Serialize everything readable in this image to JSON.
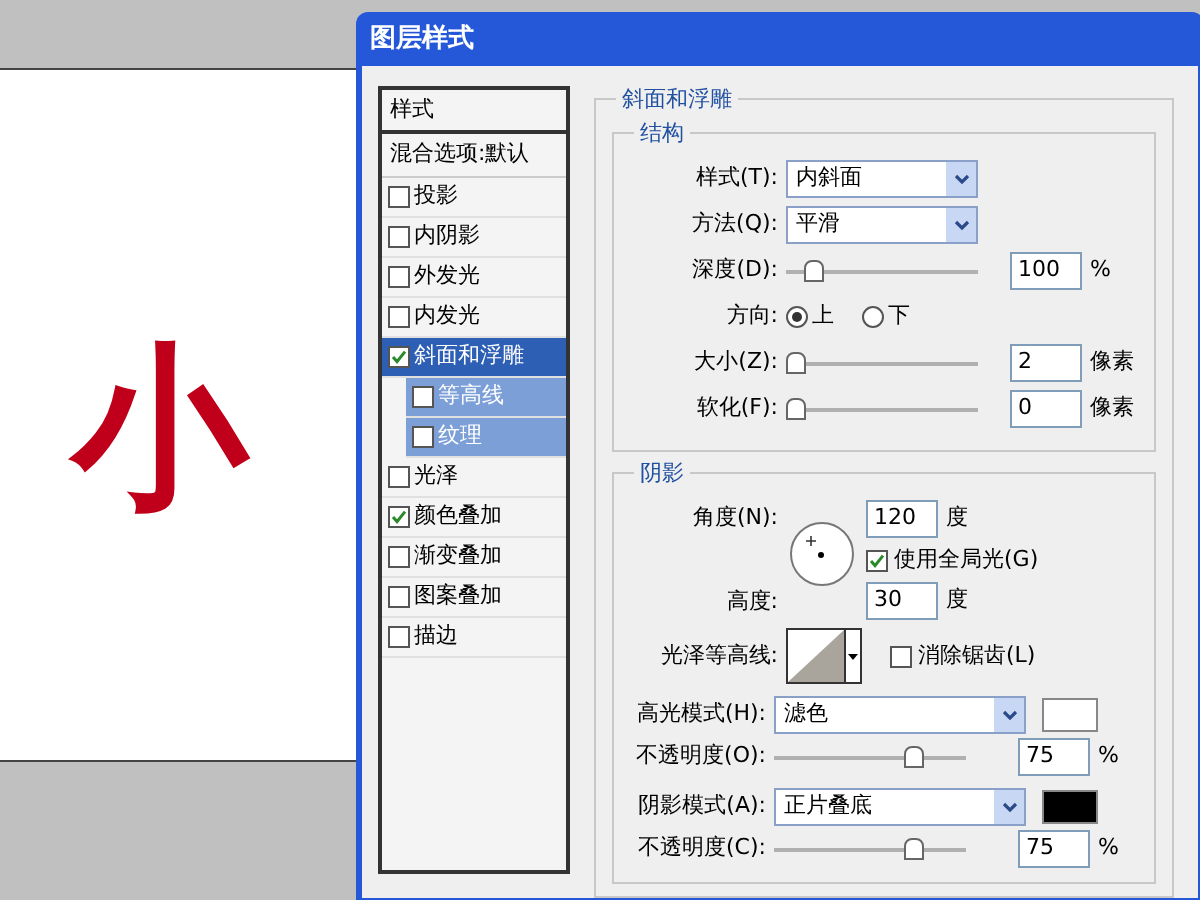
{
  "canvas": {
    "text": "小"
  },
  "window": {
    "title": "图层样式"
  },
  "styles_list": {
    "header": "样式",
    "blending": "混合选项:默认",
    "items": [
      {
        "label": "投影",
        "checked": false,
        "selected": false
      },
      {
        "label": "内阴影",
        "checked": false,
        "selected": false
      },
      {
        "label": "外发光",
        "checked": false,
        "selected": false
      },
      {
        "label": "内发光",
        "checked": false,
        "selected": false
      },
      {
        "label": "斜面和浮雕",
        "checked": true,
        "selected": true,
        "children": [
          {
            "label": "等高线",
            "checked": false,
            "selected": false
          },
          {
            "label": "纹理",
            "checked": false,
            "selected": false
          }
        ]
      },
      {
        "label": "光泽",
        "checked": false,
        "selected": false
      },
      {
        "label": "颜色叠加",
        "checked": true,
        "selected": false
      },
      {
        "label": "渐变叠加",
        "checked": false,
        "selected": false
      },
      {
        "label": "图案叠加",
        "checked": false,
        "selected": false
      },
      {
        "label": "描边",
        "checked": false,
        "selected": false
      }
    ]
  },
  "panel": {
    "title": "斜面和浮雕",
    "structure": {
      "title": "结构",
      "rows": [
        {
          "kind": "select",
          "label": "样式(T):",
          "value": "内斜面"
        },
        {
          "kind": "select",
          "label": "方法(Q):",
          "value": "平滑"
        },
        {
          "kind": "slider",
          "label": "深度(D):",
          "level": 0.1,
          "value": "100",
          "unit": "%"
        },
        {
          "kind": "radio",
          "label": "方向:",
          "options": [
            {
              "label": "上",
              "selected": true
            },
            {
              "label": "下",
              "selected": false
            }
          ]
        },
        {
          "kind": "slider",
          "label": "大小(Z):",
          "level": 0,
          "value": "2",
          "unit": "像素"
        },
        {
          "kind": "slider",
          "label": "软化(F):",
          "level": 0,
          "value": "0",
          "unit": "像素"
        }
      ]
    },
    "shading": {
      "title": "阴影",
      "angle": {
        "label": "角度(N):",
        "value": "120",
        "unit": "度"
      },
      "global_light": {
        "label": "使用全局光(G)",
        "checked": true
      },
      "altitude": {
        "label": "高度:",
        "value": "30",
        "unit": "度"
      },
      "gloss_contour": {
        "label": "光泽等高线:"
      },
      "anti_aliased": {
        "label": "消除锯齿(L)",
        "checked": false
      },
      "modes": [
        {
          "label": "高光模式(H):",
          "value": "滤色",
          "color": "#ffffff",
          "opacity_label": "不透明度(O):",
          "level": 0.75,
          "opacity": "75",
          "unit": "%"
        },
        {
          "label": "阴影模式(A):",
          "value": "正片叠底",
          "color": "#000000",
          "opacity_label": "不透明度(C):",
          "level": 0.75,
          "opacity": "75",
          "unit": "%"
        }
      ]
    }
  }
}
